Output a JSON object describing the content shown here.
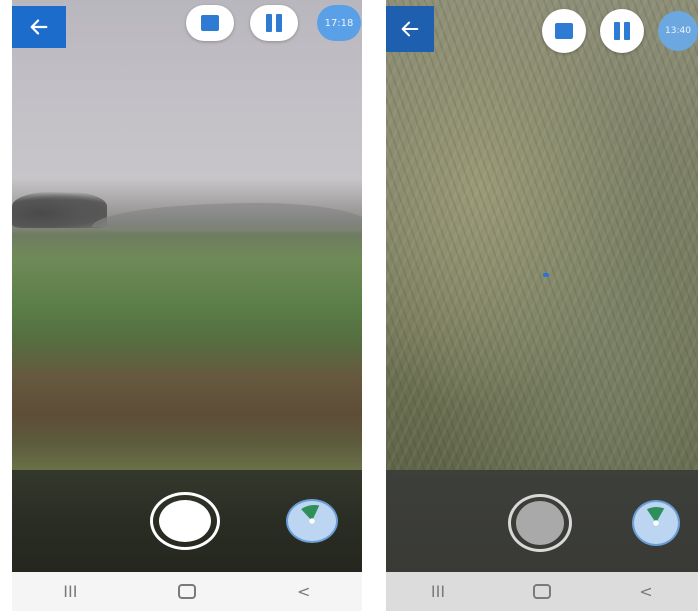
{
  "screens": [
    {
      "id": "left",
      "time_badge": "17:18",
      "nav": {
        "recents": "III",
        "back": "<"
      }
    },
    {
      "id": "right",
      "time_badge": "13:40",
      "nav": {
        "recents": "III",
        "back": "<"
      }
    }
  ],
  "icons": {
    "back": "arrow-left-icon",
    "stop": "stop-icon",
    "pause": "pause-icon",
    "shutter": "shutter-icon",
    "compass": "compass-icon",
    "recents": "recents-icon",
    "home": "home-icon",
    "nav_back": "chevron-left-icon"
  },
  "colors": {
    "accent": "#1c6ccb",
    "control_icon": "#2e7bd3",
    "time_badge": "#5aa0e6",
    "compass_wedge": "#2f8f5a"
  }
}
